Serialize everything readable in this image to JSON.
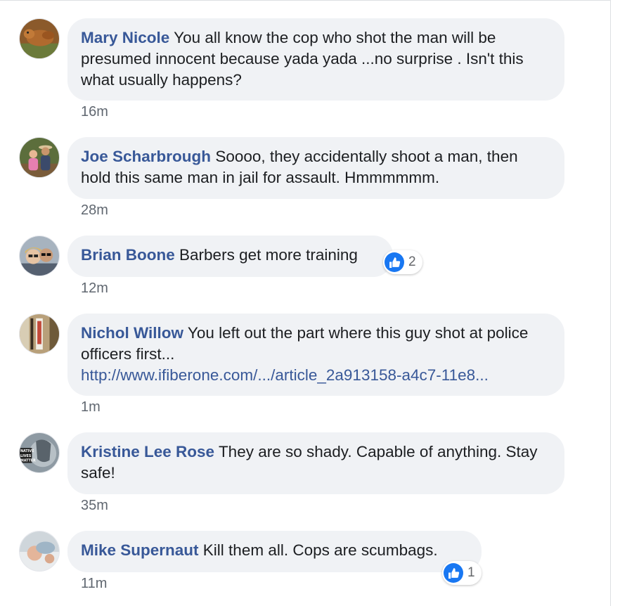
{
  "comments": [
    {
      "author": "Mary Nicole",
      "text": "You all know the cop who shot the man will be presumed innocent because yada yada ...no surprise . Isn't this what usually happens?",
      "time": "16m",
      "avatar_icon": "dog-photo-avatar"
    },
    {
      "author": "Joe Scharbrough",
      "text": "Soooo, they accidentally shoot a man, then hold this same man in jail for assault. Hmmmmmm.",
      "time": "28m",
      "avatar_icon": "couple-outdoors-avatar"
    },
    {
      "author": "Brian Boone",
      "text": "Barbers get more training",
      "time": "12m",
      "avatar_icon": "couple-selfie-avatar",
      "reaction": {
        "icon": "like-icon",
        "count": "2"
      }
    },
    {
      "author": "Nichol Willow",
      "text": "You left out the part where this guy shot at police officers first...",
      "link": "http://www.ifiberone.com/.../article_2a913158-a4c7-11e8...",
      "time": "1m",
      "avatar_icon": "figure-photo-avatar"
    },
    {
      "author": "Kristine Lee Rose",
      "text": "They are so shady. Capable of anything. Stay safe!",
      "time": "35m",
      "avatar_icon": "native-lives-badge-avatar",
      "avatar_text": "NATIVE LIVES MATTER"
    },
    {
      "author": "Mike Supernaut",
      "text": "Kill them all. Cops are scumbags.",
      "time": "11m",
      "avatar_icon": "baby-photo-avatar",
      "reaction": {
        "icon": "like-icon",
        "count": "1"
      }
    }
  ],
  "colors": {
    "author_link": "#385898",
    "bubble_bg": "#f0f2f5",
    "text": "#1c1e21",
    "timestamp": "#606770",
    "like_blue": "#1877f2"
  }
}
